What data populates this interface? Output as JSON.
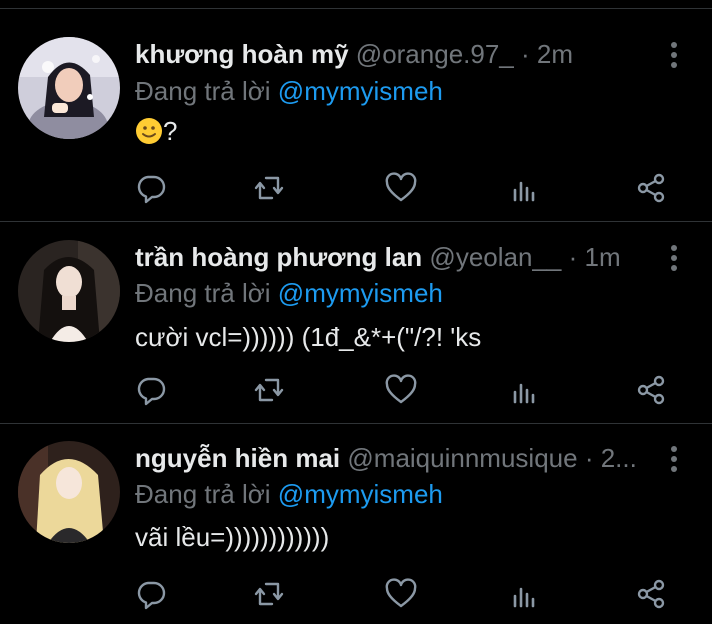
{
  "tweets": [
    {
      "name": "khương hoàn mỹ",
      "handle": "@orange.97_",
      "time": "2m",
      "reply_prefix": "Đang trả lời",
      "reply_to": "@mymyismeh",
      "text": "?",
      "emoji": "slightly-smiling-face",
      "avatar_colors": [
        "#c9c8d6",
        "#5a5870",
        "#f1c9b6"
      ]
    },
    {
      "name": "trần hoàng phương lan",
      "handle": "@yeolan__",
      "time": "1m",
      "reply_prefix": "Đang trả lời",
      "reply_to": "@mymyismeh",
      "text": "cười vcl=)))))) (1đ_&*+(\"/?! 'ks",
      "avatar_colors": [
        "#2a2522",
        "#1a1412",
        "#f2e6dc"
      ]
    },
    {
      "name": "nguyễn hiền mai",
      "handle": "@maiquinnmusique",
      "time": "2...",
      "reply_prefix": "Đang trả lời",
      "reply_to": "@mymyismeh",
      "text": "vãi lều=))))))))))))",
      "avatar_colors": [
        "#3a2620",
        "#f1dfa6",
        "#2b2a2c"
      ]
    }
  ],
  "separator": "·",
  "action_icons": [
    "reply-icon",
    "retweet-icon",
    "like-icon",
    "views-icon",
    "share-icon"
  ],
  "colors": {
    "background": "#000000",
    "text": "#e7e9ea",
    "muted": "#71767b",
    "mention": "#1d9bf0",
    "divider": "#2f3336"
  }
}
